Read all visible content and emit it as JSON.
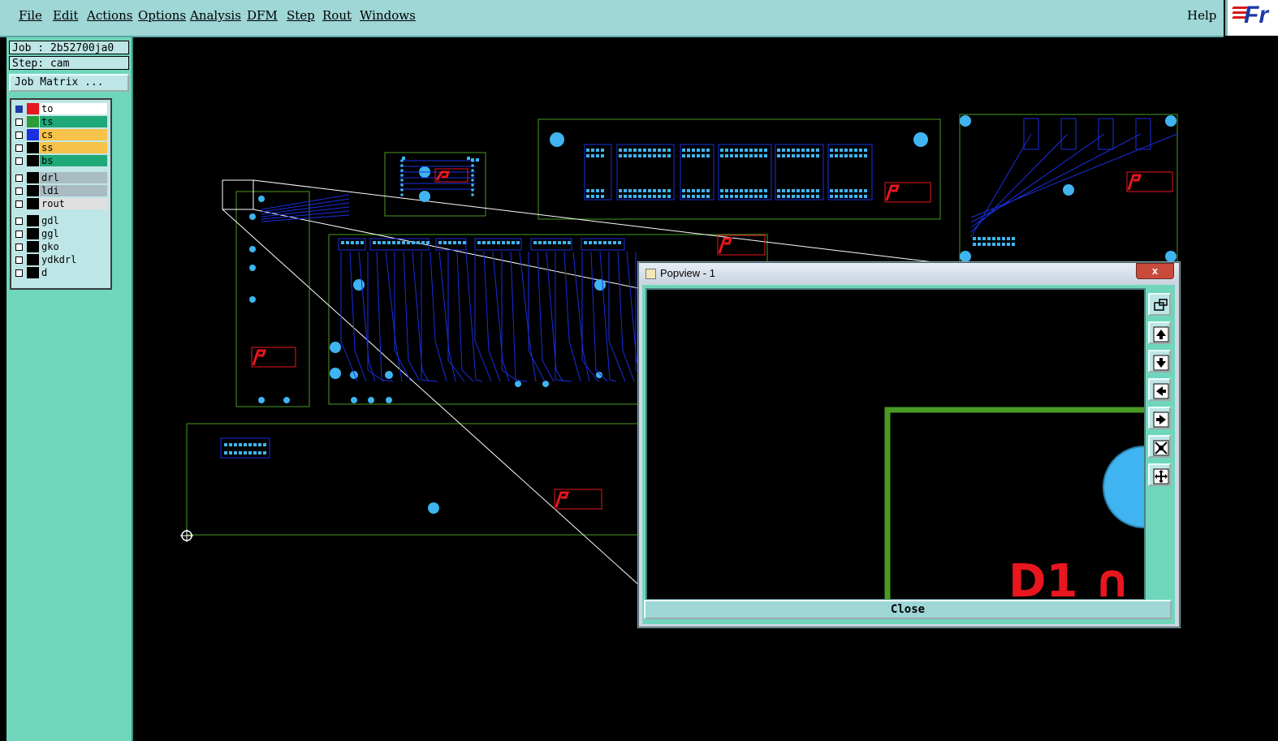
{
  "menu": {
    "items": [
      "File",
      "Edit",
      "Actions",
      "Options",
      "Analysis",
      "DFM",
      "Step",
      "Rout",
      "Windows"
    ],
    "help": "Help",
    "brand": "Fr"
  },
  "job": {
    "job_label": "Job : 2b52700ja0",
    "step_label": "Step: cam",
    "matrix_button": "Job Matrix ..."
  },
  "layers": [
    {
      "name": "to",
      "color": "#e8161e",
      "bg": "#ffffff",
      "checked": true
    },
    {
      "name": "ts",
      "color": "#2a9d3a",
      "bg": "#1fa878",
      "checked": false
    },
    {
      "name": "cs",
      "color": "#1a2fe0",
      "bg": "#f7c24a",
      "checked": false
    },
    {
      "name": "ss",
      "color": "#000000",
      "bg": "#f7c24a",
      "checked": false
    },
    {
      "name": "bs",
      "color": "#000000",
      "bg": "#1fa878",
      "checked": false
    },
    {
      "name": "drl",
      "color": "#000000",
      "bg": "#a9bcc2",
      "checked": false
    },
    {
      "name": "ldi",
      "color": "#000000",
      "bg": "#a9bcc2",
      "checked": false
    },
    {
      "name": "rout",
      "color": "#000000",
      "bg": "#e0e0e0",
      "checked": false
    },
    {
      "name": "gdl",
      "color": "#000000",
      "bg": "#bfe6e6",
      "checked": false
    },
    {
      "name": "ggl",
      "color": "#000000",
      "bg": "#bfe6e6",
      "checked": false
    },
    {
      "name": "gko",
      "color": "#000000",
      "bg": "#bfe6e6",
      "checked": false
    },
    {
      "name": "ydkdrl",
      "color": "#000000",
      "bg": "#bfe6e6",
      "checked": false
    },
    {
      "name": "d",
      "color": "#000000",
      "bg": "#bfe6e6",
      "checked": false
    }
  ],
  "popup": {
    "title": "Popview - 1",
    "close_x": "x",
    "close_button": "Close",
    "tools": [
      "zoom-window-icon",
      "pan-up-icon",
      "pan-down-icon",
      "pan-left-icon",
      "pan-right-icon",
      "zoom-in-icon",
      "zoom-out-icon"
    ],
    "view_text": "D1 ∩"
  },
  "colors": {
    "menubar": "#9fd6d6",
    "panel": "#6fd6bc",
    "board_outline": "#4a9a24",
    "pad": "#3fb4f0",
    "trace": "#1a2fe0",
    "silk": "#e8161e"
  }
}
